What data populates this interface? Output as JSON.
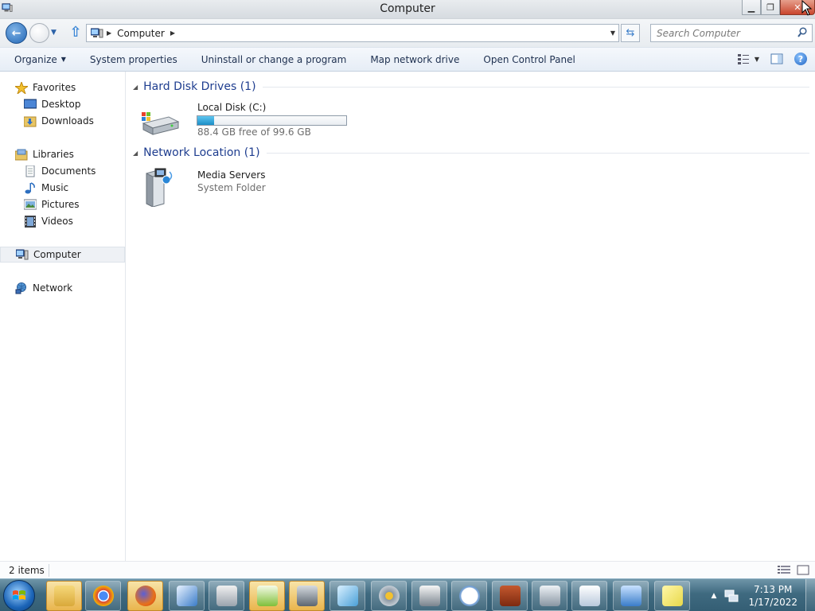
{
  "window": {
    "title": "Computer"
  },
  "address": {
    "crumbs": [
      "Computer"
    ],
    "search_placeholder": "Search Computer"
  },
  "toolbar": {
    "organize": "Organize",
    "system_properties": "System properties",
    "uninstall": "Uninstall or change a program",
    "map_network_drive": "Map network drive",
    "open_control_panel": "Open Control Panel"
  },
  "nav": {
    "favorites": "Favorites",
    "desktop": "Desktop",
    "downloads": "Downloads",
    "libraries": "Libraries",
    "documents": "Documents",
    "music": "Music",
    "pictures": "Pictures",
    "videos": "Videos",
    "computer": "Computer",
    "network": "Network"
  },
  "groups": [
    {
      "title": "Hard Disk Drives (1)",
      "items": [
        {
          "name": "Local Disk (C:)",
          "detail": "88.4 GB free of 99.6 GB",
          "used_fraction": 0.112,
          "icon": "hard-disk-icon"
        }
      ]
    },
    {
      "title": "Network Location (1)",
      "items": [
        {
          "name": "Media Servers",
          "detail": "System Folder",
          "icon": "media-server-icon"
        }
      ]
    }
  ],
  "status": {
    "item_count": "2 items"
  },
  "taskbar": {
    "time": "7:13 PM",
    "date": "1/17/2022",
    "apps": [
      "explorer",
      "chrome",
      "firefox",
      "paper-plane",
      "printer-fax",
      "notepad-chart",
      "device-manager",
      "pen-tablet",
      "sound",
      "printer",
      "clock",
      "firewall",
      "phone",
      "document-a",
      "control-panel",
      "sticky-notes"
    ]
  },
  "colors": {
    "accent_blue": "#1e3d8f",
    "capacity_fill": "#1c8fc7",
    "taskbar": "#3f6a80"
  }
}
